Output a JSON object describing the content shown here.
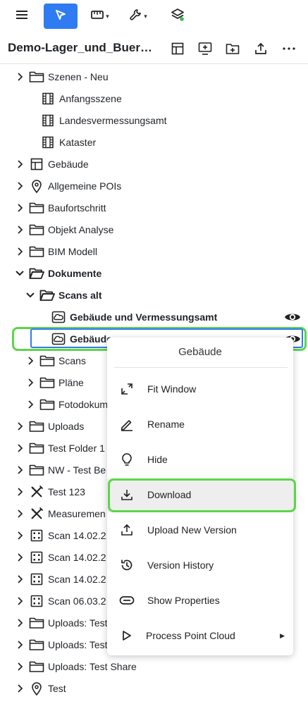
{
  "toolbar": {
    "menu_icon": "hamburger-icon",
    "select_icon": "pointer-arrow-icon",
    "measure_icon": "ruler-icon",
    "tools_icon": "wrench-icon",
    "layers_icon": "layers-icon",
    "accent": "#2f7bf2"
  },
  "project": {
    "title": "Demo-Lager_und_Buerogebäude",
    "actions": [
      "layout-icon",
      "screen-add-icon",
      "folder-add-icon",
      "upload-icon",
      "more-icon"
    ]
  },
  "tree": [
    {
      "label": "Szenen - Neu",
      "icon": "folder-icon",
      "expandable": true
    },
    {
      "label": "Anfangsszene",
      "icon": "film-icon",
      "expandable": false
    },
    {
      "label": "Landesvermessungsamt",
      "icon": "film-icon",
      "expandable": false
    },
    {
      "label": "Kataster",
      "icon": "film-icon",
      "expandable": false
    },
    {
      "label": "Gebäude",
      "icon": "building-layout-icon",
      "expandable": true
    },
    {
      "label": "Allgemeine POIs",
      "icon": "pin-icon",
      "expandable": true
    },
    {
      "label": "Baufortschritt",
      "icon": "folder-icon",
      "expandable": true
    },
    {
      "label": "Objekt Analyse",
      "icon": "folder-icon",
      "expandable": true
    },
    {
      "label": "BIM Modell",
      "icon": "folder-icon",
      "expandable": true
    },
    {
      "label": "Dokumente",
      "icon": "folder-open-icon",
      "expandable": true,
      "expanded": true,
      "bold": true
    },
    {
      "label": "Scans alt",
      "icon": "folder-open-icon",
      "expandable": true,
      "expanded": true,
      "bold": true
    },
    {
      "label": "Gebäude und Vermessungsamt",
      "icon": "cloud-icon",
      "expandable": false,
      "bold": true,
      "visible": true
    },
    {
      "label": "Gebäude",
      "icon": "cloud-icon",
      "expandable": false,
      "bold": true,
      "selected": true
    },
    {
      "label": "Scans",
      "icon": "folder-icon",
      "expandable": true
    },
    {
      "label": "Pläne",
      "icon": "folder-icon",
      "expandable": true
    },
    {
      "label": "Fotodokum",
      "icon": "folder-icon",
      "expandable": true
    },
    {
      "label": "Uploads",
      "icon": "folder-icon",
      "expandable": true
    },
    {
      "label": "Test Folder 1",
      "icon": "folder-icon",
      "expandable": true
    },
    {
      "label": "NW - Test Be",
      "icon": "folder-icon",
      "expandable": true
    },
    {
      "label": "Test 123",
      "icon": "measure-tools-icon",
      "expandable": true
    },
    {
      "label": "Measuremen",
      "icon": "measure-tools-icon",
      "expandable": true
    },
    {
      "label": "Scan 14.02.2",
      "icon": "grid-icon",
      "expandable": true
    },
    {
      "label": "Scan 14.02.2",
      "icon": "grid-icon",
      "expandable": true
    },
    {
      "label": "Scan 14.02.2",
      "icon": "grid-icon",
      "expandable": true
    },
    {
      "label": "Scan 06.03.2",
      "icon": "grid-icon",
      "expandable": true
    },
    {
      "label": "Uploads: Test",
      "icon": "folder-icon",
      "expandable": true
    },
    {
      "label": "Uploads: Test",
      "icon": "folder-icon",
      "expandable": true
    },
    {
      "label": "Uploads: Test Share",
      "icon": "folder-icon",
      "expandable": true
    },
    {
      "label": "Test",
      "icon": "pin-icon",
      "expandable": true
    }
  ],
  "context_menu": {
    "title": "Gebäude",
    "items": [
      {
        "label": "Fit Window",
        "icon": "fit-window-icon"
      },
      {
        "label": "Rename",
        "icon": "pencil-icon"
      },
      {
        "label": "Hide",
        "icon": "lightbulb-icon"
      },
      {
        "label": "Download",
        "icon": "download-icon",
        "hover": true
      },
      {
        "label": "Upload New Version",
        "icon": "upload-icon"
      },
      {
        "label": "Version History",
        "icon": "history-icon"
      },
      {
        "label": "Show Properties",
        "icon": "properties-icon"
      },
      {
        "label": "Process Point Cloud",
        "icon": "play-icon",
        "submenu": true
      }
    ]
  },
  "colors": {
    "highlight_green": "#5cd54a",
    "selection_blue": "#2f7bf2"
  }
}
